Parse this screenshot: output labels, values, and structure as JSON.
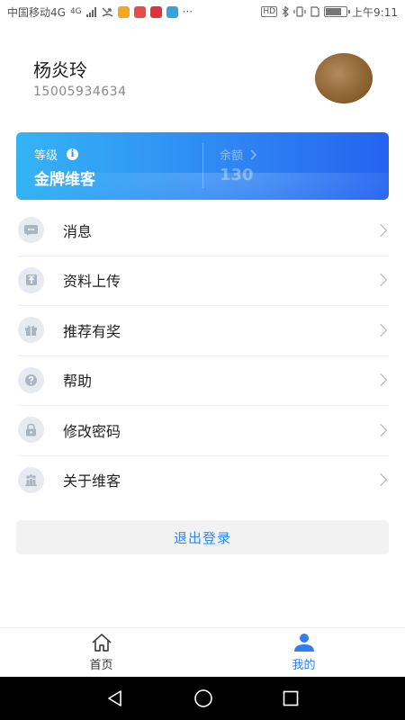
{
  "status_bar": {
    "carrier": "中国移动4G",
    "network_badge": "4G",
    "hd_badge": "HD",
    "time": "上午9:11",
    "more": "···"
  },
  "profile": {
    "name": "杨炎玲",
    "phone": "15005934634"
  },
  "level_card": {
    "level_label": "等级",
    "level_value": "金牌维客",
    "balance_label": "余额",
    "balance_value": "130"
  },
  "menu": {
    "items": [
      {
        "label": "消息",
        "icon": "message-icon"
      },
      {
        "label": "资料上传",
        "icon": "upload-icon"
      },
      {
        "label": "推荐有奖",
        "icon": "gift-icon"
      },
      {
        "label": "帮助",
        "icon": "help-icon"
      },
      {
        "label": "修改密码",
        "icon": "lock-icon"
      },
      {
        "label": "关于维客",
        "icon": "about-icon"
      }
    ]
  },
  "logout_label": "退出登录",
  "tabs": [
    {
      "label": "首页",
      "icon": "home-icon",
      "active": false
    },
    {
      "label": "我的",
      "icon": "user-icon",
      "active": true
    }
  ],
  "colors": {
    "accent": "#2f7ff0",
    "card_gradient_start": "#34b4f5",
    "card_gradient_end": "#2563f0",
    "icon_bg": "#e7ebf1"
  }
}
